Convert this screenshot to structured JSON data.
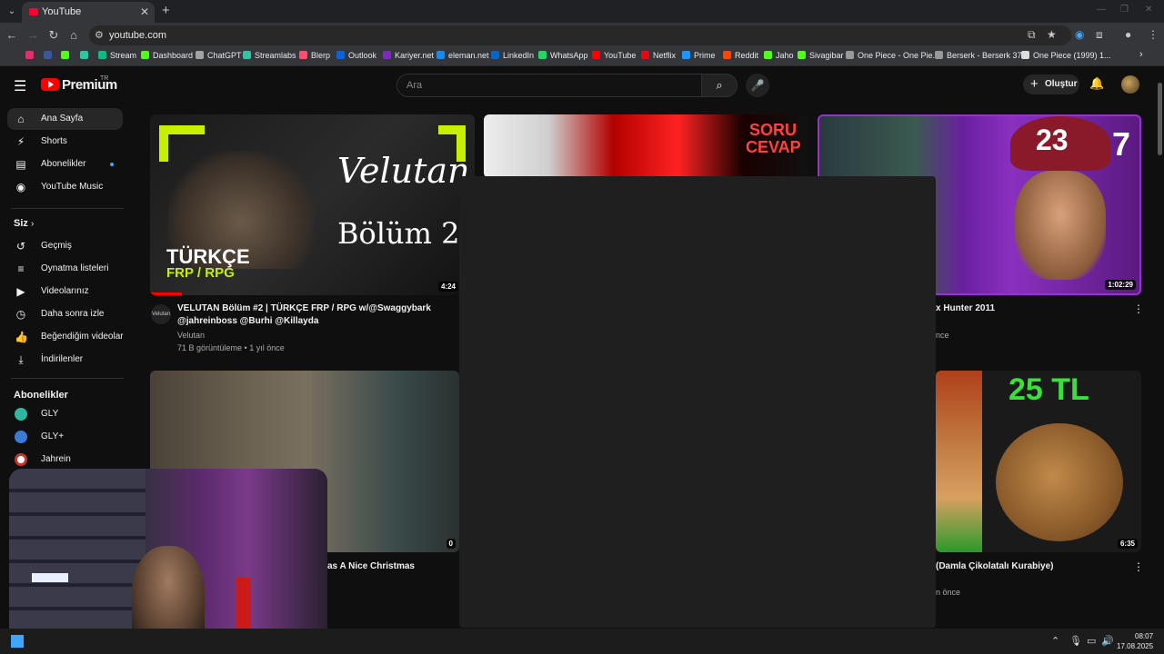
{
  "browser": {
    "tab_title": "YouTube",
    "new_tab": "+",
    "url": "youtube.com",
    "bookmarks": [
      {
        "label": "Stream",
        "color": "#10b981"
      },
      {
        "label": "Dashboard",
        "color": "#53fc18"
      },
      {
        "label": "ChatGPT",
        "color": "#a3a3a3"
      },
      {
        "label": "Streamlabs",
        "color": "#31c3a2"
      },
      {
        "label": "Blerp",
        "color": "#ff4d6d"
      },
      {
        "label": "Outlook",
        "color": "#0a64d6"
      },
      {
        "label": "Kariyer.net",
        "color": "#7b2cbf"
      },
      {
        "label": "eleman.net",
        "color": "#1e88e5"
      },
      {
        "label": "LinkedIn",
        "color": "#0a66c2"
      },
      {
        "label": "WhatsApp",
        "color": "#25d366"
      },
      {
        "label": "YouTube",
        "color": "#ff0000"
      },
      {
        "label": "Netflix",
        "color": "#e50914"
      },
      {
        "label": "Prime",
        "color": "#1a98ff"
      },
      {
        "label": "Reddit",
        "color": "#ff4500"
      },
      {
        "label": "Jaho",
        "color": "#53fc18"
      },
      {
        "label": "Sivagibar",
        "color": "#53fc18"
      },
      {
        "label": "One Piece - One Pie...",
        "color": "#999999"
      },
      {
        "label": "Berserk - Berserk 37...",
        "color": "#999999"
      },
      {
        "label": "One Piece (1999) 1...",
        "color": "#dddddd"
      }
    ]
  },
  "masthead": {
    "logo_text": "Premium",
    "country": "TR",
    "search_placeholder": "Ara",
    "create_label": "Oluştur"
  },
  "sidebar": {
    "main": [
      {
        "label": "Ana Sayfa",
        "icon": "⌂"
      },
      {
        "label": "Shorts",
        "icon": "⚡"
      },
      {
        "label": "Abonelikler",
        "icon": "▤"
      },
      {
        "label": "YouTube Music",
        "icon": "◉"
      }
    ],
    "you_header": "Siz",
    "you_items": [
      {
        "label": "Geçmiş",
        "icon": "↺"
      },
      {
        "label": "Oynatma listeleri",
        "icon": "≡"
      },
      {
        "label": "Videolarınız",
        "icon": "▶"
      },
      {
        "label": "Daha sonra izle",
        "icon": "◷"
      },
      {
        "label": "Beğendiğim videolar",
        "icon": "👍"
      },
      {
        "label": "İndirilenler",
        "icon": "⤓"
      }
    ],
    "subs_header": "Abonelikler",
    "subs": [
      {
        "label": "GLY",
        "color": "#2fb8a0"
      },
      {
        "label": "GLY+",
        "color": "#3a7bd5"
      },
      {
        "label": "Jahrein",
        "color": "#c0392b"
      }
    ]
  },
  "videos": [
    {
      "title_line1": "VELUTAN Bölüm #2 | TÜRKÇE FRP / RPG w/@Swaggybark",
      "title_line2": "@jahreinboss @Burhi  @Killayda",
      "channel": "Velutan",
      "meta": "71 B görüntüleme • 1 yıl önce",
      "duration": "4:24",
      "thumb_text_big": "Velutan",
      "thumb_text_sub": "Bölüm 2",
      "thumb_badge": "TÜRKÇE",
      "thumb_badge2": "FRP / RPG",
      "channel_avatar": "Velutan"
    },
    {
      "title_partial": "x Hunter 2011",
      "meta_partial": "nce",
      "duration": "1:02:29",
      "thumb_number": "23",
      "thumb_corner": "7"
    },
    {
      "title_partial": "as A Nice Christmas",
      "duration": "0"
    },
    {
      "title_partial": "(Damla Çikolatalı Kurabiye)",
      "meta_partial": "n önce",
      "duration": "6:35",
      "thumb_price": "25 TL"
    },
    {
      "thumb_text": "SORU CEVAP"
    }
  ],
  "taskbar": {
    "time": "08:07",
    "date": "17.08.2025"
  }
}
